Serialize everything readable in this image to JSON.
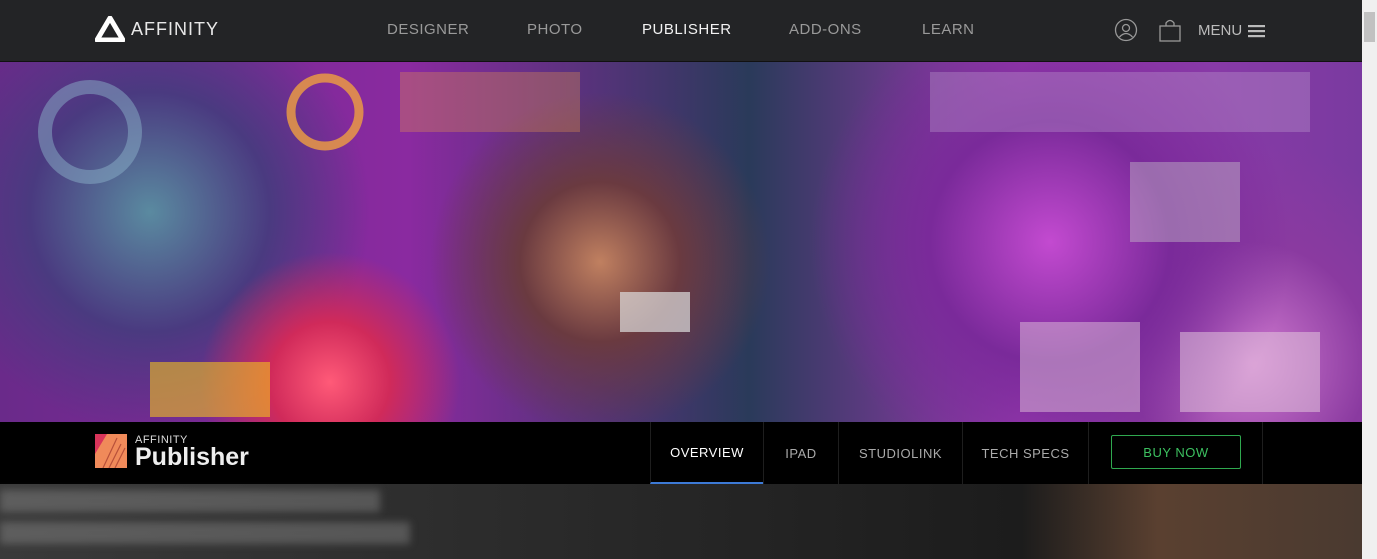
{
  "header": {
    "brand": "AFFINITY",
    "nav": [
      "DESIGNER",
      "PHOTO",
      "PUBLISHER",
      "ADD-ONS",
      "LEARN"
    ],
    "active_nav": "PUBLISHER",
    "menu_label": "MENU"
  },
  "product_bar": {
    "brand_small": "AFFINITY",
    "product": "Publisher",
    "tabs": [
      "OVERVIEW",
      "IPAD",
      "STUDIOLINK",
      "TECH SPECS"
    ],
    "active_tab": "OVERVIEW",
    "buy_label": "BUY NOW"
  },
  "colors": {
    "accent_tab": "#3d7ad6",
    "buy": "#3cc060",
    "header_bg": "#232426"
  }
}
